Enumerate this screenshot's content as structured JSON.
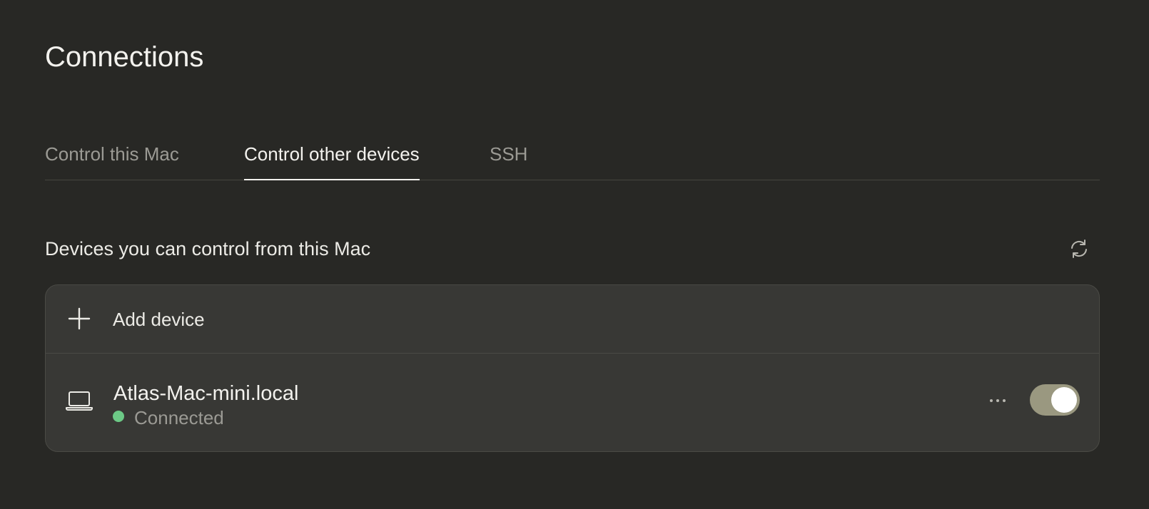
{
  "page": {
    "title": "Connections"
  },
  "tabs": [
    {
      "label": "Control this Mac",
      "active": false
    },
    {
      "label": "Control other devices",
      "active": true
    },
    {
      "label": "SSH",
      "active": false
    }
  ],
  "section": {
    "title": "Devices you can control from this Mac",
    "refresh_icon": "refresh-icon"
  },
  "add_device": {
    "label": "Add device",
    "icon": "plus-icon"
  },
  "devices": [
    {
      "name": "Atlas-Mac-mini.local",
      "status": "Connected",
      "status_color": "#6cc986",
      "icon": "laptop-icon",
      "enabled": true
    }
  ],
  "colors": {
    "background": "#282825",
    "card": "#383835",
    "toggle_on": "#9a9880"
  }
}
